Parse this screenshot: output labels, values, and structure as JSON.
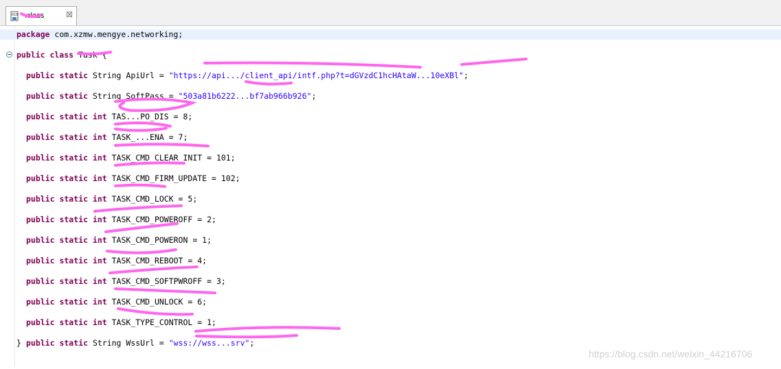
{
  "tab": {
    "label": " .class",
    "close_glyph": "☒",
    "icon": "class-file-icon"
  },
  "code": {
    "package_kw": "package",
    "package_name": " com.xzmw.mengye.networking;",
    "class_decl_kw": "public class",
    "class_name": " Task {",
    "lines": [
      {
        "kw": "public static",
        "type": " String ApiUrl = ",
        "str": "\"https://api.../client_api/intf.php?t=dGVzdC1hcHAtaW...10eXBl\"",
        "tail": ";"
      },
      {
        "kw": "public static",
        "type": " String SoftPass = ",
        "str": "\"503a81b6222...bf7ab966b926\"",
        "tail": ";"
      },
      {
        "kw": "public static int",
        "type": " TAS...PO_DIS = 8;",
        "str": "",
        "tail": ""
      },
      {
        "kw": "public static int",
        "type": " TASK_...ENA = 7;",
        "str": "",
        "tail": ""
      },
      {
        "kw": "public static int",
        "type": " TASK_CMD_CLEAR_INIT = 101;",
        "str": "",
        "tail": ""
      },
      {
        "kw": "public static int",
        "type": " TASK_CMD_FIRM_UPDATE = 102;",
        "str": "",
        "tail": ""
      },
      {
        "kw": "public static int",
        "type": " TASK_CMD_LOCK = 5;",
        "str": "",
        "tail": ""
      },
      {
        "kw": "public static int",
        "type": " TASK_CMD_POWEROFF = 2;",
        "str": "",
        "tail": ""
      },
      {
        "kw": "public static int",
        "type": " TASK_CMD_POWERON = 1;",
        "str": "",
        "tail": ""
      },
      {
        "kw": "public static int",
        "type": " TASK_CMD_REBOOT = 4;",
        "str": "",
        "tail": ""
      },
      {
        "kw": "public static int",
        "type": " TASK_CMD_SOFTPWROFF = 3;",
        "str": "",
        "tail": ""
      },
      {
        "kw": "public static int",
        "type": " TASK_CMD_UNLOCK = 6;",
        "str": "",
        "tail": ""
      },
      {
        "kw": "public static int",
        "type": " TASK_TYPE_CONTROL = 1;",
        "str": "",
        "tail": ""
      },
      {
        "kw": "public static",
        "type": " String WssUrl = ",
        "str": "\"wss://wss...srv\"",
        "tail": ";"
      }
    ],
    "closing": "}"
  },
  "watermark": "https://blog.csdn.net/weixin_44216706",
  "colors": {
    "keyword": "#7f0055",
    "string": "#2a00ff",
    "redaction": "#ff66ee",
    "current_line": "#e8f2fe"
  }
}
